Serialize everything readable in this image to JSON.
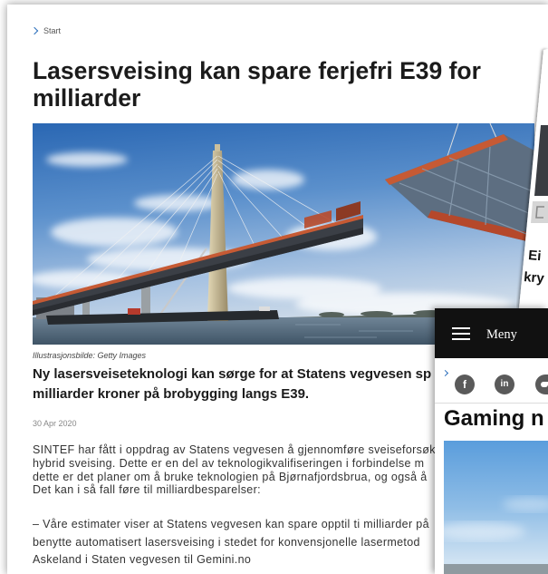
{
  "main_article": {
    "breadcrumb": {
      "icon": "chevron-right-icon",
      "label": "Start"
    },
    "title": "Lasersveising kan spare ferjefri E39 for milliarder",
    "image_caption": "Illustrasjonsbilde: Getty Images",
    "lead_lines": [
      "Ny lasersveiseteknologi kan sørge for at Statens vegvesen sp",
      "milliarder kroner på brobygging langs E39."
    ],
    "date": "30 Apr 2020",
    "paragraphs": [
      {
        "lines": [
          "SINTEF har fått i oppdrag av Statens vegvesen å gjennomføre sveiseforsøk",
          "hybrid sveising. Dette er en del av teknologikvalifiseringen i forbindelse m",
          "dette er det planer om å bruke teknologien på Bjørnafjordsbrua, og også å",
          "Det kan i så fall føre til milliardbesparelser:"
        ]
      },
      {
        "lines": [
          "– Våre estimater viser at Statens vegvesen kan spare opptil ti milliarder på",
          "benytte automatisert lasersveising i stedet for konvensjonelle lasermetod",
          "Askeland i Staten vegvesen til Gemini.no"
        ]
      }
    ]
  },
  "side_card": {
    "text_lines": [
      "Ei",
      "kry"
    ]
  },
  "mobile_card": {
    "menu_icon": "hamburger-icon",
    "menu_label": "Meny",
    "back_icon": "chevron-right-icon",
    "share_icons": [
      {
        "icon": "facebook-icon",
        "glyph": "f"
      },
      {
        "icon": "linkedin-icon",
        "glyph": "in"
      },
      {
        "icon": "twitter-icon"
      }
    ],
    "headline": "Gaming n"
  },
  "colors": {
    "link_blue": "#2a6ebb",
    "title_text": "#1b1b1b",
    "body_text": "#333333",
    "menu_bar": "#111111",
    "share_icon_bg": "#5a5a5a"
  }
}
